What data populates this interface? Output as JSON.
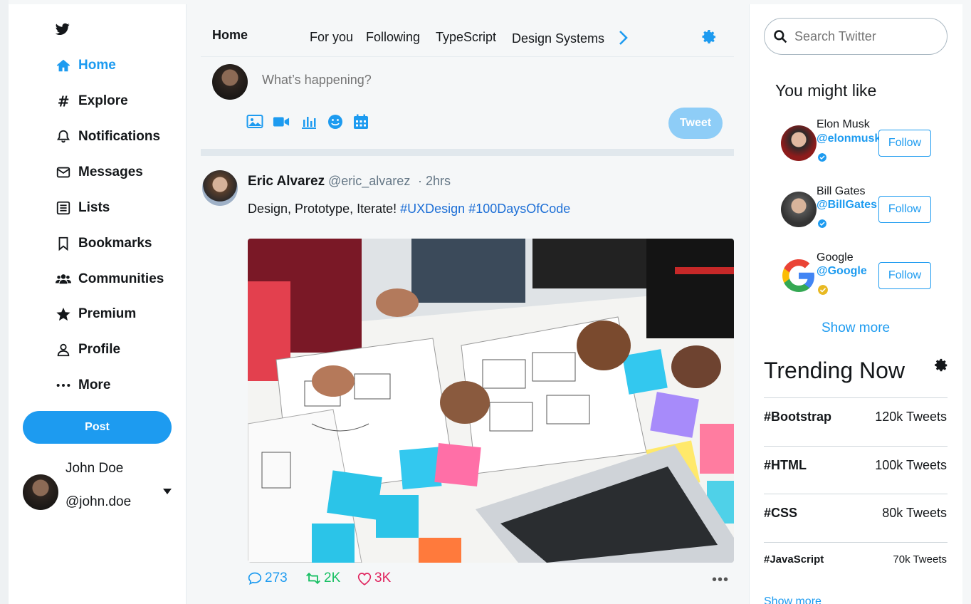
{
  "nav": {
    "items": [
      {
        "label": "Home",
        "icon": "home-icon",
        "active": true
      },
      {
        "label": "Explore",
        "icon": "hashtag-icon"
      },
      {
        "label": "Notifications",
        "icon": "bell-icon"
      },
      {
        "label": "Messages",
        "icon": "envelope-icon"
      },
      {
        "label": "Lists",
        "icon": "list-icon"
      },
      {
        "label": "Bookmarks",
        "icon": "bookmark-icon"
      },
      {
        "label": "Communities",
        "icon": "users-icon"
      },
      {
        "label": "Premium",
        "icon": "star-icon"
      },
      {
        "label": "Profile",
        "icon": "user-icon"
      },
      {
        "label": "More",
        "icon": "ellipsis-icon"
      }
    ],
    "post_label": "Post"
  },
  "user": {
    "name": "John Doe",
    "handle": "@john.doe"
  },
  "header": {
    "title": "Home",
    "tabs": [
      "For you",
      "Following",
      "TypeScript",
      "Design Systems"
    ]
  },
  "composer": {
    "placeholder": "What’s happening?",
    "tweet_label": "Tweet"
  },
  "post": {
    "author": "Eric Alvarez",
    "handle": "@eric_alvarez",
    "time": "· 2hrs",
    "text": "Design, Prototype, Iterate!",
    "hashtags": [
      "#UXDesign",
      "#100DaysOfCode"
    ],
    "replies": "273",
    "retweets": "2K",
    "likes": "3K"
  },
  "search": {
    "placeholder": "Search Twitter"
  },
  "suggestions": {
    "title": "You might like",
    "follow_label": "Follow",
    "show_more": "Show more",
    "items": [
      {
        "name": "Elon Musk",
        "handle": "@elonmusk",
        "badge_color": "#1d9bf0"
      },
      {
        "name": "Bill Gates",
        "handle": "@BillGates",
        "badge_color": "#1d9bf0"
      },
      {
        "name": "Google",
        "handle": "@Google",
        "badge_color": "#e8b923"
      }
    ]
  },
  "trending": {
    "title": "Trending Now",
    "show_more": "Show more",
    "items": [
      {
        "tag": "#Bootstrap",
        "count": "120k Tweets"
      },
      {
        "tag": "#HTML",
        "count": "100k Tweets"
      },
      {
        "tag": "#CSS",
        "count": "80k Tweets"
      },
      {
        "tag": "#JavaScript",
        "count": "70k Tweets"
      }
    ]
  },
  "colors": {
    "accent": "#1d9bf0",
    "retweet": "#17bf63",
    "like": "#e0245e"
  }
}
